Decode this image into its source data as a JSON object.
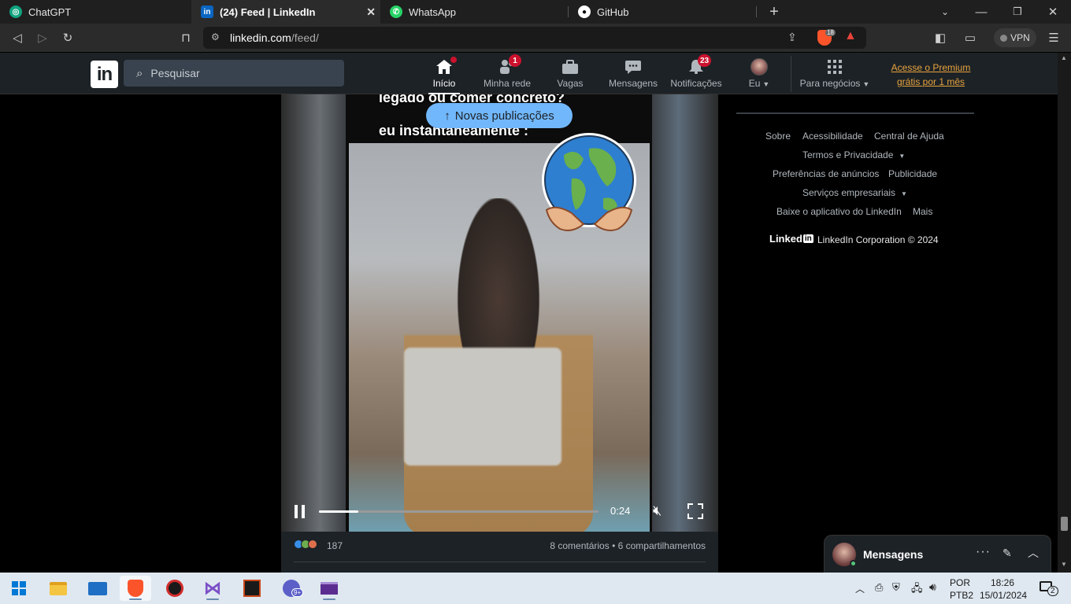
{
  "browser": {
    "tabs": [
      {
        "title": "ChatGPT",
        "icon": "chatgpt-icon"
      },
      {
        "title": "(24) Feed | LinkedIn",
        "icon": "linkedin-icon",
        "active": true
      },
      {
        "title": "WhatsApp",
        "icon": "whatsapp-icon"
      },
      {
        "title": "GitHub",
        "icon": "github-icon"
      }
    ],
    "url_host": "linkedin.com",
    "url_path": "/feed/",
    "shield_count": "18",
    "vpn_label": "VPN"
  },
  "linkedin": {
    "logo_text": "in",
    "search_placeholder": "Pesquisar",
    "nav": [
      {
        "label": "Início",
        "icon": "home-icon",
        "badge": "",
        "dot": true,
        "active": true
      },
      {
        "label": "Minha rede",
        "icon": "network-icon",
        "badge": "1"
      },
      {
        "label": "Vagas",
        "icon": "briefcase-icon",
        "badge": ""
      },
      {
        "label": "Mensagens",
        "icon": "chat-icon",
        "badge": ""
      },
      {
        "label": "Notificações",
        "icon": "bell-icon",
        "badge": "23"
      },
      {
        "label": "Eu",
        "icon": "avatar-icon",
        "badge": ""
      },
      {
        "label": "Para negócios",
        "icon": "grid-icon",
        "badge": ""
      }
    ],
    "premium_line1": "Acesse o Premium",
    "premium_line2": "grátis por 1 mês"
  },
  "feed": {
    "new_posts_label": "Novas publicações",
    "video_caption_line1": "legado ou comer concreto?",
    "video_caption_line2": "eu instantaneamente :",
    "video_time": "0:24",
    "video_progress": 0.14,
    "reactions_count": "187",
    "comments": "8 comentários",
    "shares": "6 compartilhamentos"
  },
  "rail": {
    "links": [
      "Sobre",
      "Acessibilidade",
      "Central de Ajuda",
      "Termos e Privacidade",
      "Preferências de anúncios",
      "Publicidade",
      "Serviços empresariais",
      "Baixe o aplicativo do LinkedIn",
      "Mais"
    ],
    "brand_text": "Linked",
    "copyright": "LinkedIn Corporation © 2024"
  },
  "messaging": {
    "title": "Mensagens"
  },
  "taskbar": {
    "apps": [
      "file-explorer-icon",
      "mail-icon",
      "brave-icon",
      "shield-app-icon",
      "visual-studio-icon",
      "game-icon",
      "chat-app-icon",
      "terminal-icon"
    ],
    "chat_badge": "9+",
    "lang1": "POR",
    "lang2": "PTB2",
    "time": "18:26",
    "date": "15/01/2024",
    "notif_count": "2"
  },
  "colors": {
    "linkedin_nav": "#1d2226",
    "accent_blue": "#71b7fb",
    "badge_red": "#cb112d",
    "premium_gold": "#e7a33e"
  }
}
